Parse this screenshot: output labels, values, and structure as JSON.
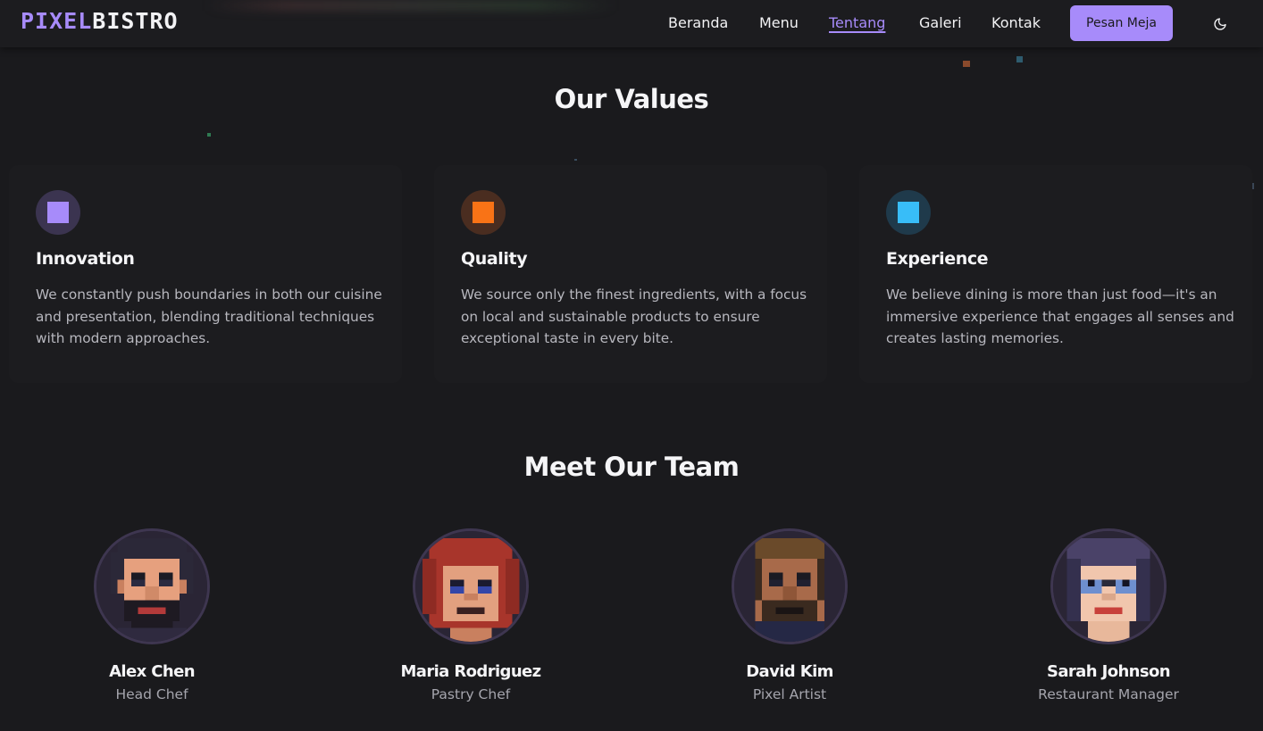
{
  "nav": {
    "logo_part1": "PIXEL",
    "logo_part2": "BISTRO",
    "links": [
      "Beranda",
      "Menu",
      "Tentang",
      "Galeri",
      "Kontak"
    ],
    "active_link": "Tentang",
    "cta_label": "Pesan Meja",
    "theme_toggle_icon": "moon-icon"
  },
  "values": {
    "title": "Our Values",
    "items": [
      {
        "title": "Innovation",
        "description": "We constantly push boundaries in both our cuisine and presentation, blending traditional techniques with modern approaches.",
        "icon": "purple-square-icon",
        "color": "#a78bfa"
      },
      {
        "title": "Quality",
        "description": "We source only the finest ingredients, with a focus on local and sustainable products to ensure exceptional taste in every bite.",
        "icon": "orange-square-icon",
        "color": "#f97316"
      },
      {
        "title": "Experience",
        "description": "We believe dining is more than just food—it's an immersive experience that engages all senses and creates lasting memories.",
        "icon": "blue-square-icon",
        "color": "#38bdf8"
      }
    ]
  },
  "team": {
    "title": "Meet Our Team",
    "members": [
      {
        "name": "Alex Chen",
        "role": "Head Chef"
      },
      {
        "name": "Maria Rodriguez",
        "role": "Pastry Chef"
      },
      {
        "name": "David Kim",
        "role": "Pixel Artist"
      },
      {
        "name": "Sarah Johnson",
        "role": "Restaurant Manager"
      }
    ]
  },
  "colors": {
    "accent": "#a78bfa",
    "background": "#1a1a1d",
    "card": "#1c1c1f",
    "text_muted": "#b7b7be"
  }
}
